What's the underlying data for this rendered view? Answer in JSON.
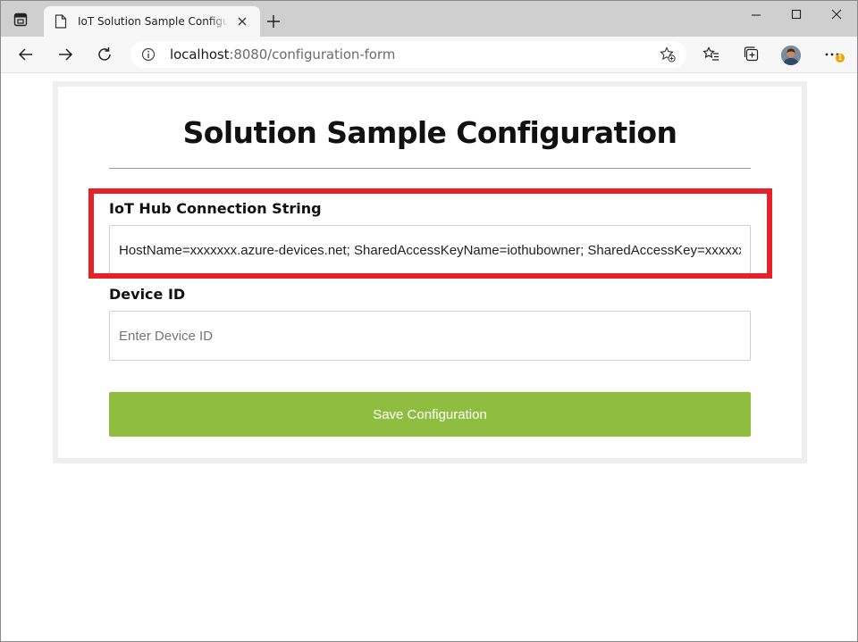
{
  "browser": {
    "tab_title": "IoT Solution Sample Configuration",
    "url_host": "localhost",
    "url_rest": ":8080/configuration-form",
    "notification_count": "1"
  },
  "form": {
    "heading": "Solution Sample Configuration",
    "connection_label": "IoT Hub Connection String",
    "connection_value": "HostName=xxxxxxx.azure-devices.net; SharedAccessKeyName=iothubowner; SharedAccessKey=xxxxxxxxxxxxxxxx",
    "device_label": "Device ID",
    "device_value": "",
    "device_placeholder": "Enter Device ID",
    "save_label": "Save Configuration"
  },
  "colors": {
    "save_button": "#8fbd3f",
    "highlight_box": "#e52228",
    "tab_strip": "#cfcfcf"
  }
}
